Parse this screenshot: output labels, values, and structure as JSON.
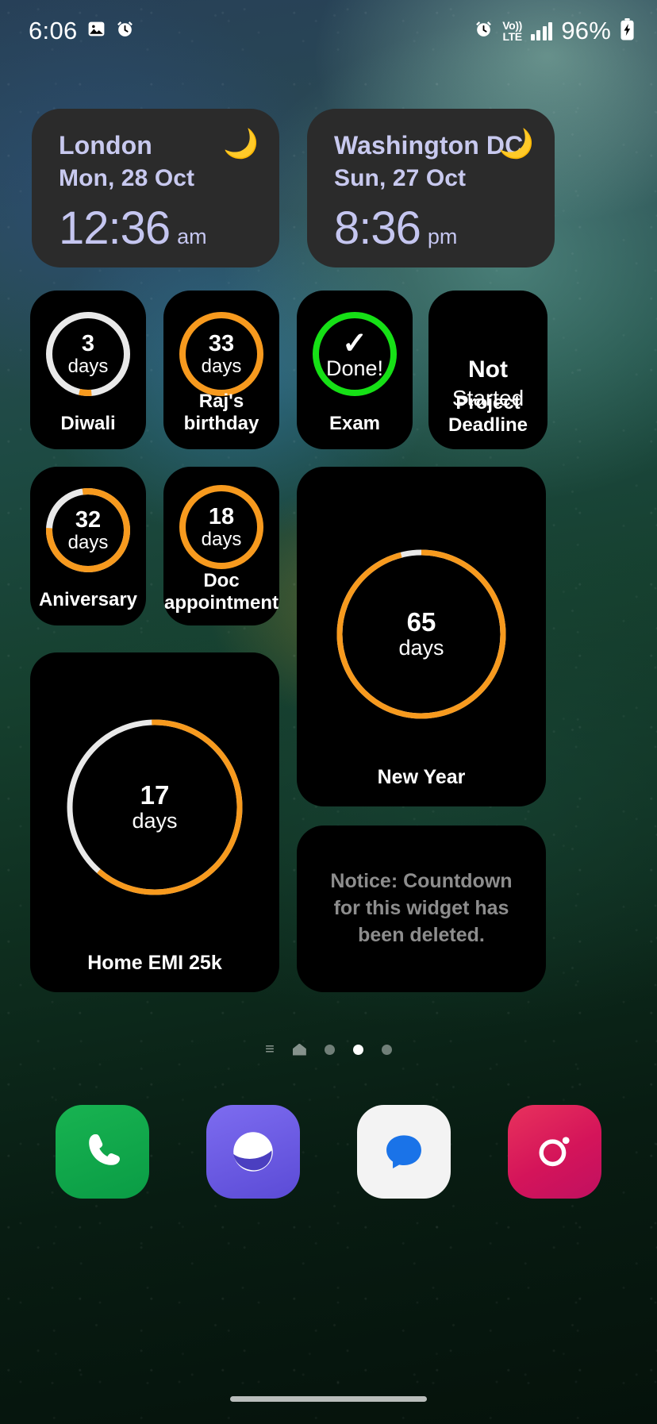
{
  "status_bar": {
    "time": "6:06",
    "left_icons": [
      "photos-icon",
      "alarm-icon"
    ],
    "right_icons": [
      "alarm-icon",
      "volte-icon",
      "signal-icon",
      "battery-charging-icon"
    ],
    "volte_top": "Vo))",
    "volte_bottom": "LTE",
    "battery_percent": "96%"
  },
  "clock_widgets": [
    {
      "city": "London",
      "date": "Mon, 28 Oct",
      "time": "12:36",
      "meridiem": "am",
      "icon": "moon-icon",
      "glyph": "🌙"
    },
    {
      "city": "Washington DC",
      "date": "Sun, 27 Oct",
      "time": "8:36",
      "meridiem": "pm",
      "icon": "moon-icon",
      "glyph": "🌙"
    }
  ],
  "countdowns": [
    {
      "id": "diwali",
      "label": "Diwali",
      "value": "3",
      "unit": "days",
      "progress_pct": 5,
      "ring_color": "#f79a1e",
      "track_color": "#e9e9e9",
      "style": "ring"
    },
    {
      "id": "raj",
      "label": "Raj's birthday",
      "value": "33",
      "unit": "days",
      "progress_pct": 100,
      "ring_color": "#f79a1e",
      "track_color": "#f79a1e",
      "style": "ring"
    },
    {
      "id": "exam",
      "label": "Exam",
      "value": "✓",
      "unit": "Done!",
      "progress_pct": 100,
      "ring_color": "#16e016",
      "track_color": "#16e016",
      "style": "done"
    },
    {
      "id": "project",
      "label": "Project\nDeadline",
      "value": "Not",
      "unit": "Started",
      "progress_pct": 0,
      "ring_color": "#ffffff",
      "track_color": "#ffffff",
      "style": "text"
    },
    {
      "id": "anniversary",
      "label": "Aniversary",
      "value": "32",
      "unit": "days",
      "progress_pct": 78,
      "ring_color": "#f79a1e",
      "track_color": "#e9e9e9",
      "style": "ring"
    },
    {
      "id": "doc",
      "label": "Doc\nappointment",
      "value": "18",
      "unit": "days",
      "progress_pct": 100,
      "ring_color": "#f79a1e",
      "track_color": "#f79a1e",
      "style": "ring"
    },
    {
      "id": "newyear",
      "label": "New Year",
      "value": "65",
      "unit": "days",
      "progress_pct": 96,
      "ring_color": "#f79a1e",
      "track_color": "#e9e9e9",
      "style": "ring"
    },
    {
      "id": "emi",
      "label": "Home EMI 25k",
      "value": "17",
      "unit": "days",
      "progress_pct": 62,
      "ring_color": "#f79a1e",
      "track_color": "#e9e9e9",
      "style": "ring"
    }
  ],
  "notice_widget": {
    "text": "Notice: Countdown for this widget has been deleted."
  },
  "labels": {
    "diwali": "Diwali",
    "raj": "Raj's birthday",
    "exam": "Exam",
    "project_line1": "Project",
    "project_line2": "Deadline",
    "anniversary": "Aniversary",
    "doc_line1": "Doc",
    "doc_line2": "appointment",
    "newyear": "New Year",
    "emi": "Home EMI 25k"
  },
  "values": {
    "diwali_num": "3",
    "diwali_unit": "days",
    "raj_num": "33",
    "raj_unit": "days",
    "exam_check": "✓",
    "exam_done": "Done!",
    "project_l1": "Not",
    "project_l2": "Started",
    "anniv_num": "32",
    "anniv_unit": "days",
    "doc_num": "18",
    "doc_unit": "days",
    "newyear_num": "65",
    "newyear_unit": "days",
    "emi_num": "17",
    "emi_unit": "days"
  },
  "page_indicator": {
    "total_pages": 4,
    "active_index": 2,
    "has_list_icon": true,
    "has_home_icon": true
  },
  "dock": [
    {
      "name": "phone",
      "label": "Phone",
      "color": "#12b34e"
    },
    {
      "name": "internet",
      "label": "Internet",
      "color": "#6a5af0"
    },
    {
      "name": "messages",
      "label": "Messages",
      "color": "#f2f2f2"
    },
    {
      "name": "camera",
      "label": "Instagram",
      "color": "#d4145a"
    }
  ],
  "colors": {
    "accent_orange": "#f79a1e",
    "accent_green": "#16e016",
    "widget_bg": "#000000",
    "clock_bg": "#2b2b2b",
    "clock_text": "#c8c9ef",
    "notice_text": "#8d8d8d"
  }
}
